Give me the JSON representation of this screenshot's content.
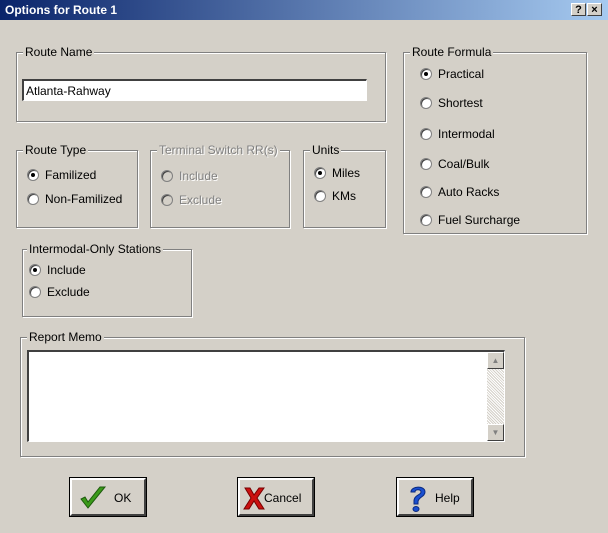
{
  "window": {
    "title": "Options for Route 1",
    "help_glyph": "?",
    "close_glyph": "×"
  },
  "route_name": {
    "legend": "Route Name",
    "value": "Atlanta-Rahway"
  },
  "route_formula": {
    "legend": "Route Formula",
    "options": [
      {
        "label": "Practical",
        "checked": true
      },
      {
        "label": "Shortest",
        "checked": false
      },
      {
        "label": "Intermodal",
        "checked": false
      },
      {
        "label": "Coal/Bulk",
        "checked": false
      },
      {
        "label": "Auto Racks",
        "checked": false
      },
      {
        "label": "Fuel Surcharge",
        "checked": false
      }
    ]
  },
  "route_type": {
    "legend": "Route Type",
    "options": [
      {
        "label": "Familized",
        "checked": true
      },
      {
        "label": "Non-Familized",
        "checked": false
      }
    ]
  },
  "terminal_switch": {
    "legend": "Terminal Switch RR(s)",
    "disabled": true,
    "options": [
      {
        "label": "Include",
        "checked": false
      },
      {
        "label": "Exclude",
        "checked": false
      }
    ]
  },
  "units": {
    "legend": "Units",
    "options": [
      {
        "label": "Miles",
        "checked": true
      },
      {
        "label": "KMs",
        "checked": false
      }
    ]
  },
  "intermodal_only": {
    "legend": "Intermodal-Only Stations",
    "options": [
      {
        "label": "Include",
        "checked": true
      },
      {
        "label": "Exclude",
        "checked": false
      }
    ]
  },
  "report_memo": {
    "legend": "Report Memo",
    "value": ""
  },
  "buttons": {
    "ok": "OK",
    "cancel": "Cancel",
    "help": "Help"
  },
  "colors": {
    "titlebar_start": "#0a246a",
    "titlebar_end": "#a6caf0",
    "face": "#d4d0c8",
    "ok_check": "#3a9a1a",
    "cancel_x": "#cc1010",
    "help_q": "#1a4fd0"
  }
}
